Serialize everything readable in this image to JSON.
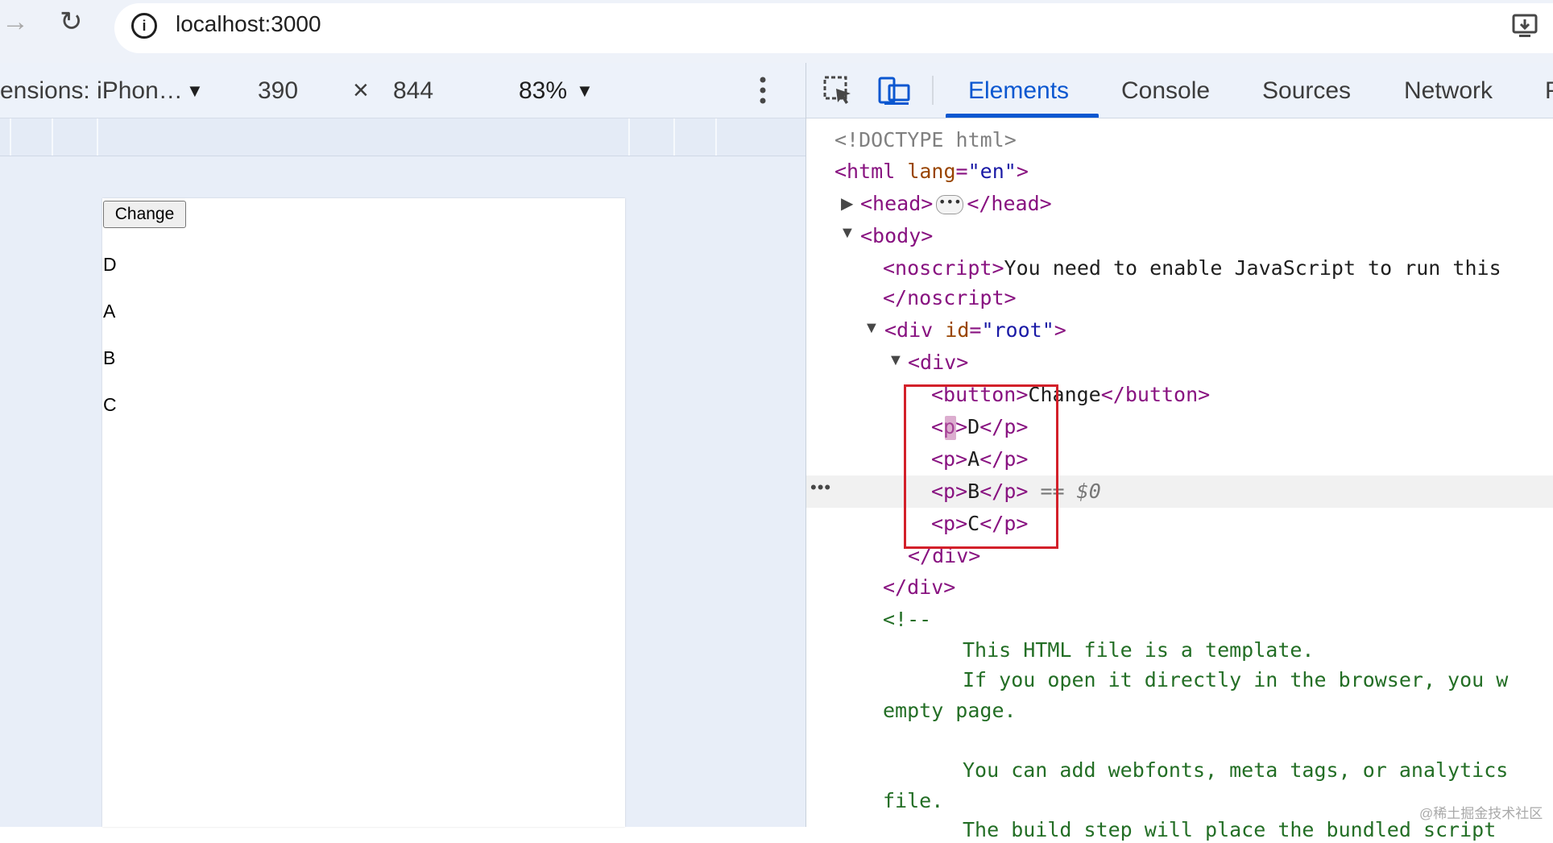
{
  "browser": {
    "url": "localhost:3000",
    "icons": {
      "forward": "forward-arrow-icon",
      "reload": "reload-icon",
      "site_info": "info-icon",
      "install": "install-app-icon"
    }
  },
  "device_toolbar": {
    "dimensions_label": "ensions: iPhon…",
    "width": "390",
    "times": "×",
    "height": "844",
    "zoom": "83%"
  },
  "page": {
    "button_label": "Change",
    "items": [
      "D",
      "A",
      "B",
      "C"
    ]
  },
  "devtools": {
    "tabs": [
      "Elements",
      "Console",
      "Sources",
      "Network",
      "P"
    ],
    "active_tab": "Elements",
    "dom": {
      "doctype": "<!DOCTYPE html>",
      "html_open_tag": "<html",
      "html_lang_attr": " lang",
      "html_lang_val": "\"en\"",
      "html_close_bracket": ">",
      "head_open": "<head>",
      "head_close": "</head>",
      "body_open": "<body>",
      "noscript_open": "<noscript>",
      "noscript_text": "You need to enable JavaScript to run this",
      "noscript_close": "</noscript>",
      "div_root_open": "<div",
      "div_root_attr": " id",
      "div_root_val": "\"root\"",
      "div_open": "<div>",
      "button_open": "<button>",
      "button_text": "Change",
      "button_close": "</button>",
      "p_open": "<p>",
      "p_close": "</p>",
      "p_values": [
        "D",
        "A",
        "B",
        "C"
      ],
      "selected_marker": "== $0",
      "div_close": "</div>",
      "comment_open": "<!--",
      "comment_lines": [
        "This HTML file is a template.",
        "If you open it directly in the browser, you w",
        "empty page.",
        "You can add webfonts, meta tags, or analytics",
        "file.",
        "The build step will place the bundled script"
      ]
    }
  },
  "watermark": "@稀土掘金技术社区"
}
